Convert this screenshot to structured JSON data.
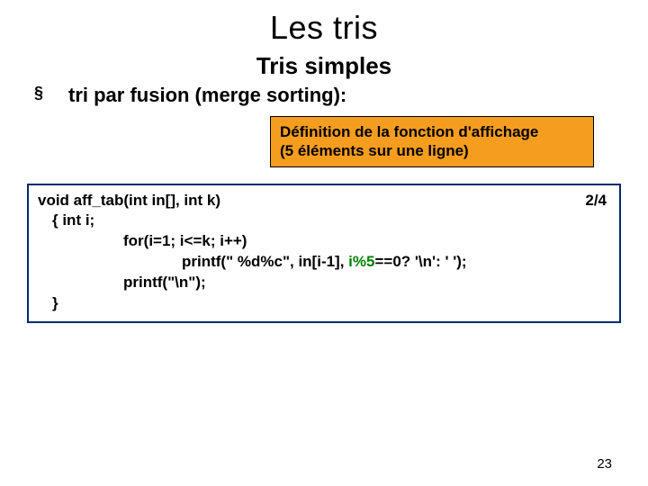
{
  "title": "Les tris",
  "subtitle": "Tris simples",
  "bullet": {
    "marker": "§",
    "text": "tri par fusion (merge sorting):"
  },
  "annotation": {
    "line1": "Définition de la fonction d'affichage",
    "line2": "(5 éléments sur une ligne)"
  },
  "code": {
    "pageIndicator": "2/4",
    "l1": "void aff_tab(int in[], int k)",
    "l2": " {  int i;",
    "l3": "for(i=1; i<=k; i++)",
    "l4a": "printf(\" %d%c\", in[i-1], ",
    "l4b": "i%5",
    "l4c": "==0? '\\n': ' ');",
    "l5": "printf(\"\\n\");",
    "l6": " }"
  },
  "slideNumber": "23"
}
